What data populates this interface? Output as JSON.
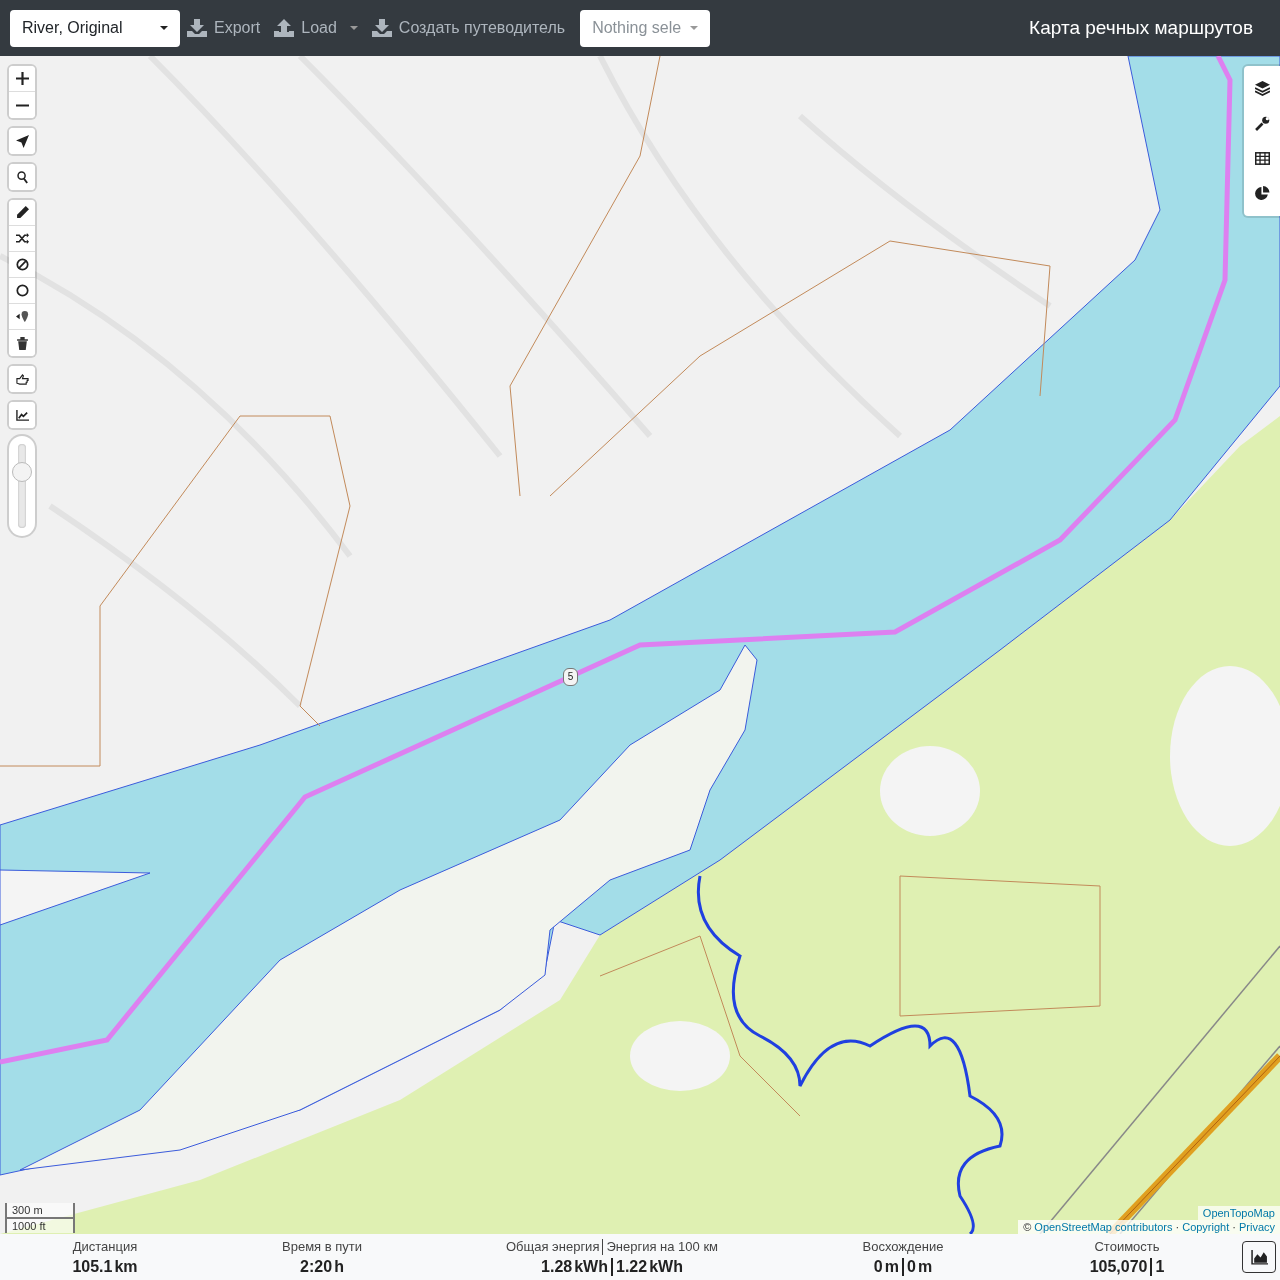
{
  "top_bar": {
    "profile_select": {
      "value": "River, Original"
    },
    "actions": [
      {
        "label": "Export",
        "kind": "download",
        "dropdown": false
      },
      {
        "label": "Load",
        "kind": "upload",
        "dropdown": true
      },
      {
        "label": "Создать путеводитель",
        "kind": "download",
        "dropdown": false
      }
    ],
    "selection_select": {
      "placeholder": "Nothing sele"
    },
    "title": "Карта речных маршрутов"
  },
  "map": {
    "opacity_slider": {
      "level": 0.75
    },
    "route_marker": "5",
    "scale": {
      "metric": "300 m",
      "imperial": "1000 ft"
    },
    "attribution": {
      "tiles": "OpenTopoMap",
      "sign": "©",
      "osm": "OpenStreetMap contributors",
      "separators": [
        "·",
        "·"
      ],
      "copyright": "Copyright",
      "privacy": "Privacy"
    }
  },
  "stats": [
    {
      "labels": [
        "Дистанция"
      ],
      "values": [
        {
          "number": "105.1",
          "unit": "km"
        }
      ]
    },
    {
      "labels": [
        "Время в пути"
      ],
      "values": [
        {
          "number": "2:20",
          "unit": "h"
        }
      ]
    },
    {
      "labels": [
        "Общая энергия",
        "Энергия на 100 км"
      ],
      "values": [
        {
          "number": "1.28",
          "unit": "kWh"
        },
        {
          "number": "1.22",
          "unit": "kWh"
        }
      ]
    },
    {
      "labels": [
        "Восхождение"
      ],
      "values": [
        {
          "number": "0",
          "unit": "m"
        },
        {
          "number": "0",
          "unit": "m"
        }
      ]
    },
    {
      "labels": [
        "Стоимость"
      ],
      "values": [
        {
          "number": "105,070"
        },
        {
          "number": "1"
        }
      ]
    }
  ]
}
